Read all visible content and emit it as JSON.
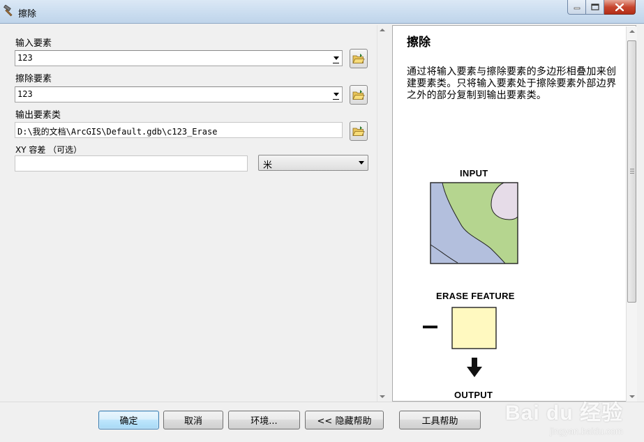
{
  "window": {
    "title": "擦除"
  },
  "form": {
    "input_features_label": "输入要素",
    "input_features_value": "123",
    "erase_features_label": "擦除要素",
    "erase_features_value": "123",
    "output_class_label": "输出要素类",
    "output_class_value": "D:\\我的文档\\ArcGIS\\Default.gdb\\c123_Erase",
    "xy_tolerance_label": "XY 容差 （可选）",
    "xy_tolerance_value": "",
    "unit_value": "米"
  },
  "help": {
    "title": "擦除",
    "description": "通过将输入要素与擦除要素的多边形相叠加来创建要素类。只将输入要素处于擦除要素外部边界之外的部分复制到输出要素类。",
    "figure_input_label": "INPUT",
    "figure_erase_label": "ERASE FEATURE",
    "figure_output_label": "OUTPUT",
    "colors": {
      "green_area": "#b5d58f",
      "blue_area": "#b3bfdd",
      "lilac_area": "#e6dce8",
      "erase_fill": "#fff9c0"
    }
  },
  "buttons": {
    "ok": "确定",
    "cancel": "取消",
    "environments": "环境...",
    "hide_help": "<< 隐藏帮助",
    "tool_help": "工具帮助"
  },
  "watermark": {
    "main": "Bai du 经验",
    "sub": "jingyan.baidu.com"
  }
}
